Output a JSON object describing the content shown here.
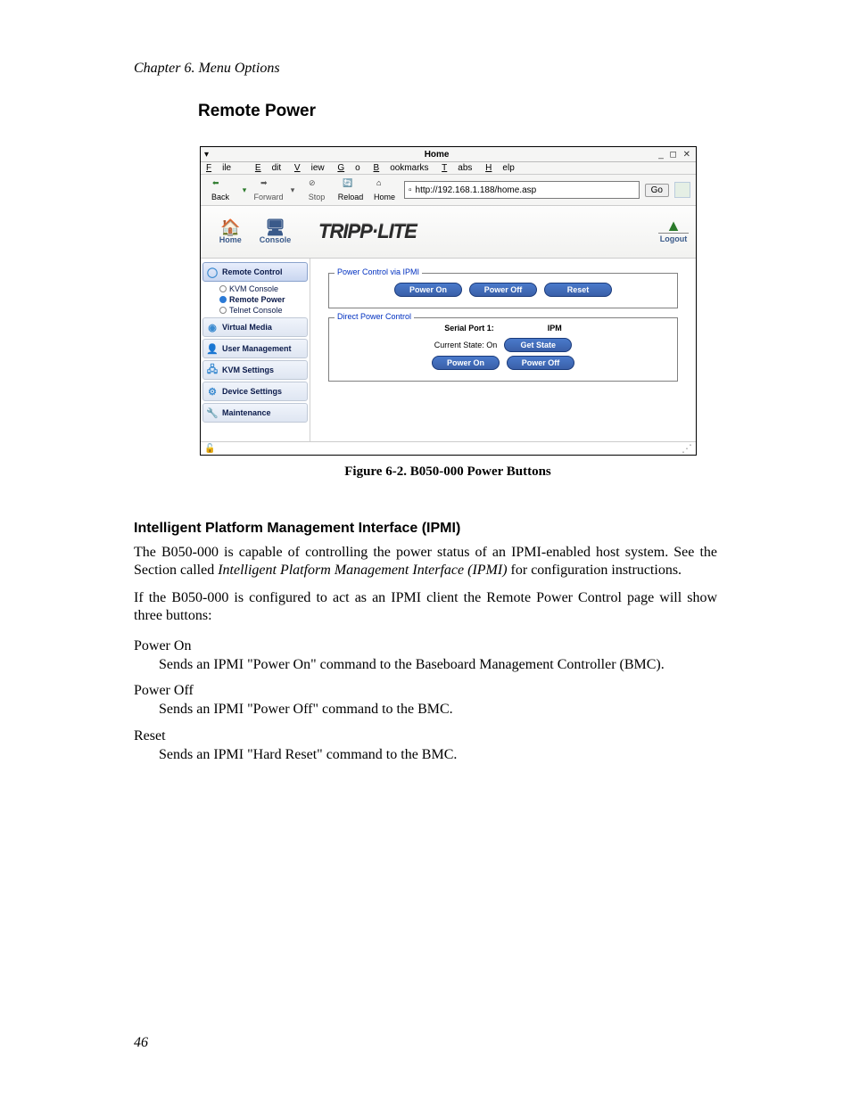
{
  "chapter_header": "Chapter 6. Menu Options",
  "section_title": "Remote Power",
  "figure_caption": "Figure 6-2. B050-000 Power Buttons",
  "subsection_title": "Intelligent Platform Management Interface (IPMI)",
  "para1_a": "The B050-000 is capable of controlling the power status of an IPMI-enabled host system. See the Section called ",
  "para1_ital": "Intelligent Platform Management Interface (IPMI)",
  "para1_b": " for configuration instructions.",
  "para2": "If the B050-000 is configured to act as an IPMI client the Remote Power Control page will show three buttons:",
  "defs": {
    "d1_t": "Power On",
    "d1_d": "Sends an IPMI \"Power On\" command to the Baseboard Management Controller (BMC).",
    "d2_t": "Power Off",
    "d2_d": "Sends an IPMI \"Power Off\" command to the BMC.",
    "d3_t": "Reset",
    "d3_d": "Sends an IPMI \"Hard Reset\" command to the BMC."
  },
  "page_number": "46",
  "browser": {
    "window_title": "Home",
    "menus": {
      "file": "File",
      "edit": "Edit",
      "view": "View",
      "go": "Go",
      "bookmarks": "Bookmarks",
      "tabs": "Tabs",
      "help": "Help"
    },
    "toolbar": {
      "back": "Back",
      "forward": "Forward",
      "stop": "Stop",
      "reload": "Reload",
      "home": "Home",
      "go": "Go"
    },
    "url": "http://192.168.1.188/home.asp"
  },
  "app": {
    "header": {
      "home": "Home",
      "console": "Console",
      "logo": "TRIPP·LITE",
      "logout": "Logout"
    },
    "sidebar": {
      "remote_control": "Remote Control",
      "kvm_console": "KVM Console",
      "remote_power": "Remote Power",
      "telnet_console": "Telnet Console",
      "virtual_media": "Virtual Media",
      "user_management": "User Management",
      "kvm_settings": "KVM Settings",
      "device_settings": "Device Settings",
      "maintenance": "Maintenance"
    },
    "ipmi_box": {
      "legend": "Power Control via IPMI",
      "power_on": "Power On",
      "power_off": "Power Off",
      "reset": "Reset"
    },
    "direct_box": {
      "legend": "Direct Power Control",
      "serial_label": "Serial Port 1:",
      "serial_val": "IPM",
      "state_label": "Current State: On",
      "get_state": "Get State",
      "power_on": "Power On",
      "power_off": "Power Off"
    }
  }
}
